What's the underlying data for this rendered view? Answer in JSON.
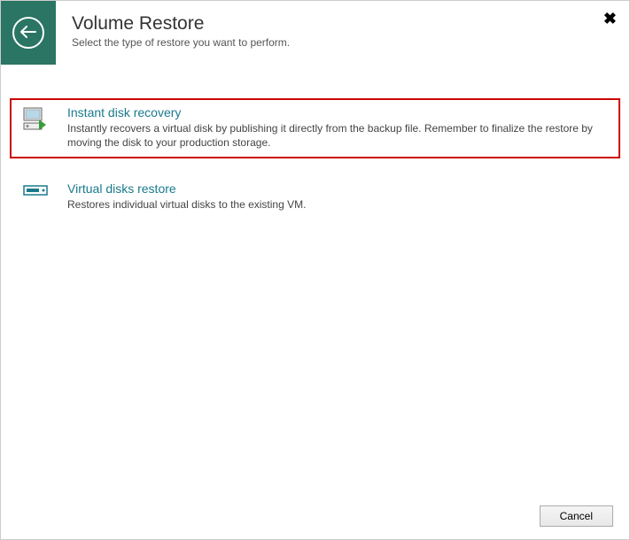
{
  "header": {
    "title": "Volume Restore",
    "subtitle": "Select the type of restore you want to perform."
  },
  "options": {
    "instant": {
      "title": "Instant disk recovery",
      "description": "Instantly recovers a virtual disk by publishing it directly from the backup file. Remember to finalize the restore by moving the disk to your production storage."
    },
    "virtual": {
      "title": "Virtual disks restore",
      "description": "Restores individual virtual disks to the existing VM."
    }
  },
  "buttons": {
    "cancel": "Cancel"
  }
}
